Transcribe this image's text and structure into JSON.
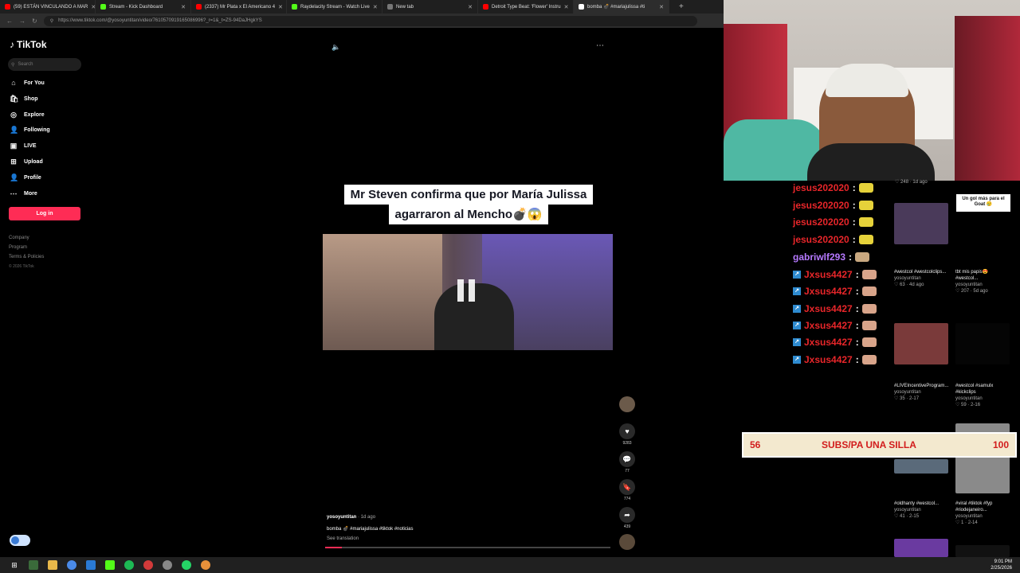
{
  "browser": {
    "tabs": [
      {
        "label": "(59) ESTÁN VINCULANDO A MAR",
        "color": "#ff0000"
      },
      {
        "label": "Stream - Kick Dashboard",
        "color": "#53fc18"
      },
      {
        "label": "(2337) Mr Plata x El Americano 4",
        "color": "#ff0000"
      },
      {
        "label": "Raydelacity Stream - Watch Live",
        "color": "#53fc18"
      },
      {
        "label": "New tab",
        "color": "#777777"
      },
      {
        "label": "Detroit Type Beat: 'Flower' Instru",
        "color": "#ff0000"
      },
      {
        "label": "bomba 💣 #mariajulissa #ti",
        "color": "#ffffff"
      }
    ],
    "url": "https://www.tiktok.com/@yosoyuntitan/video/7610570919165086996?_r=1&_t=ZS-94DaJHgkYS"
  },
  "tiktok": {
    "logo": "TikTok",
    "search_placeholder": "Search",
    "nav": [
      {
        "label": "For You",
        "icon": "home-icon",
        "glyph": "⌂"
      },
      {
        "label": "Shop",
        "icon": "shop-icon",
        "glyph": "🛍"
      },
      {
        "label": "Explore",
        "icon": "compass-icon",
        "glyph": "◎"
      },
      {
        "label": "Following",
        "icon": "following-icon",
        "glyph": "👤"
      },
      {
        "label": "LIVE",
        "icon": "live-icon",
        "glyph": "▣"
      },
      {
        "label": "Upload",
        "icon": "upload-icon",
        "glyph": "⊞"
      },
      {
        "label": "Profile",
        "icon": "profile-icon",
        "glyph": "👤"
      },
      {
        "label": "More",
        "icon": "more-icon",
        "glyph": "⋯"
      }
    ],
    "login_label": "Log in",
    "footer": [
      "Company",
      "Program",
      "Terms & Policies",
      "© 2026 TikTok"
    ],
    "video": {
      "caption_line1": "Mr Steven confirma que por María Julissa",
      "caption_line2": "agarraron al Mencho💣😱",
      "author": "yosoyuntitan",
      "posted": "· 1d ago",
      "description": "bomba 💣 #mariajulissa #tiktok #noticias",
      "see_translation": "See translation",
      "likes": "9283",
      "comments": "77",
      "saves": "774",
      "shares": "439",
      "progress": 0.06
    }
  },
  "chat": [
    {
      "user": "jesus202020",
      "color": "#e8262a",
      "badge": false
    },
    {
      "user": "jesus202020",
      "color": "#e8262a",
      "badge": false
    },
    {
      "user": "jesus202020",
      "color": "#e8262a",
      "badge": false
    },
    {
      "user": "jesus202020",
      "color": "#e8262a",
      "badge": false
    },
    {
      "user": "gabriwlf293",
      "color": "#b679ff",
      "badge": false
    },
    {
      "user": "Jxsus4427",
      "color": "#e8262a",
      "badge": true
    },
    {
      "user": "Jxsus4427",
      "color": "#e8262a",
      "badge": true
    },
    {
      "user": "Jxsus4427",
      "color": "#e8262a",
      "badge": true
    },
    {
      "user": "Jxsus4427",
      "color": "#e8262a",
      "badge": true
    },
    {
      "user": "Jxsus4427",
      "color": "#e8262a",
      "badge": true
    },
    {
      "user": "Jxsus4427",
      "color": "#e8262a",
      "badge": true
    }
  ],
  "recommendations": {
    "top_meta_left": "♡ 248 · 1d ago",
    "top_meta_right": "Un gol más para el Goat 😢",
    "items": [
      {
        "title": "#westcol #westcolclips...",
        "author": "yosoyuntitan",
        "meta": "♡ 63 · 4d ago",
        "thumb": "#4a3a5a"
      },
      {
        "title": "tbt mis papis😍 #westcol...",
        "author": "yosoyuntitan",
        "meta": "♡ 207 · 5d ago",
        "thumb": "#000000"
      },
      {
        "title": "#LIVEIncentiveProgram...",
        "author": "yosoyuntitan",
        "meta": "♡ 35 · 2-17",
        "thumb": "#7a3a3a"
      },
      {
        "title": "#westcol #samulx #kickclips",
        "author": "yosoyuntitan",
        "meta": "♡ 59 · 2-16",
        "thumb": "#000000"
      },
      {
        "title": "#oldhanty #westcol...",
        "author": "yosoyuntitan",
        "meta": "♡ 41 · 2-15",
        "thumb": "#5a6a7a"
      },
      {
        "title": "#viral #tiktok #fyp #riodejaneiro...",
        "author": "yosoyuntitan",
        "meta": "♡ 1 · 2-14",
        "thumb": "#8a8a8a"
      }
    ]
  },
  "subs_goal": {
    "current": "56",
    "label": "SUBS/PA UNA SILLA",
    "goal": "100"
  },
  "taskbar": {
    "time": "9:01 PM",
    "date": "2/25/2026"
  }
}
